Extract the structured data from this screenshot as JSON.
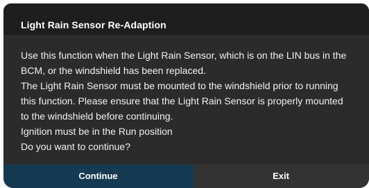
{
  "dialog": {
    "title": "Light Rain Sensor Re-Adaption",
    "message_lines": [
      "Use this function when the Light Rain Sensor, which is on the LIN bus in the",
      "BCM, or the windshield has been replaced.",
      "The Light Rain Sensor must be mounted to the windshield prior to running",
      "this function. Please ensure that the Light Rain Sensor is properly mounted",
      "to the windshield before continuing.",
      "Ignition must be in the Run position",
      "Do you want to continue?"
    ],
    "buttons": {
      "continue_label": "Continue",
      "exit_label": "Exit"
    }
  },
  "colors": {
    "title_bg": "#1e1e1e",
    "body_bg": "#2b2b2b",
    "continue_bg": "#163a52",
    "exit_bg": "#333333",
    "text": "#ffffff"
  }
}
